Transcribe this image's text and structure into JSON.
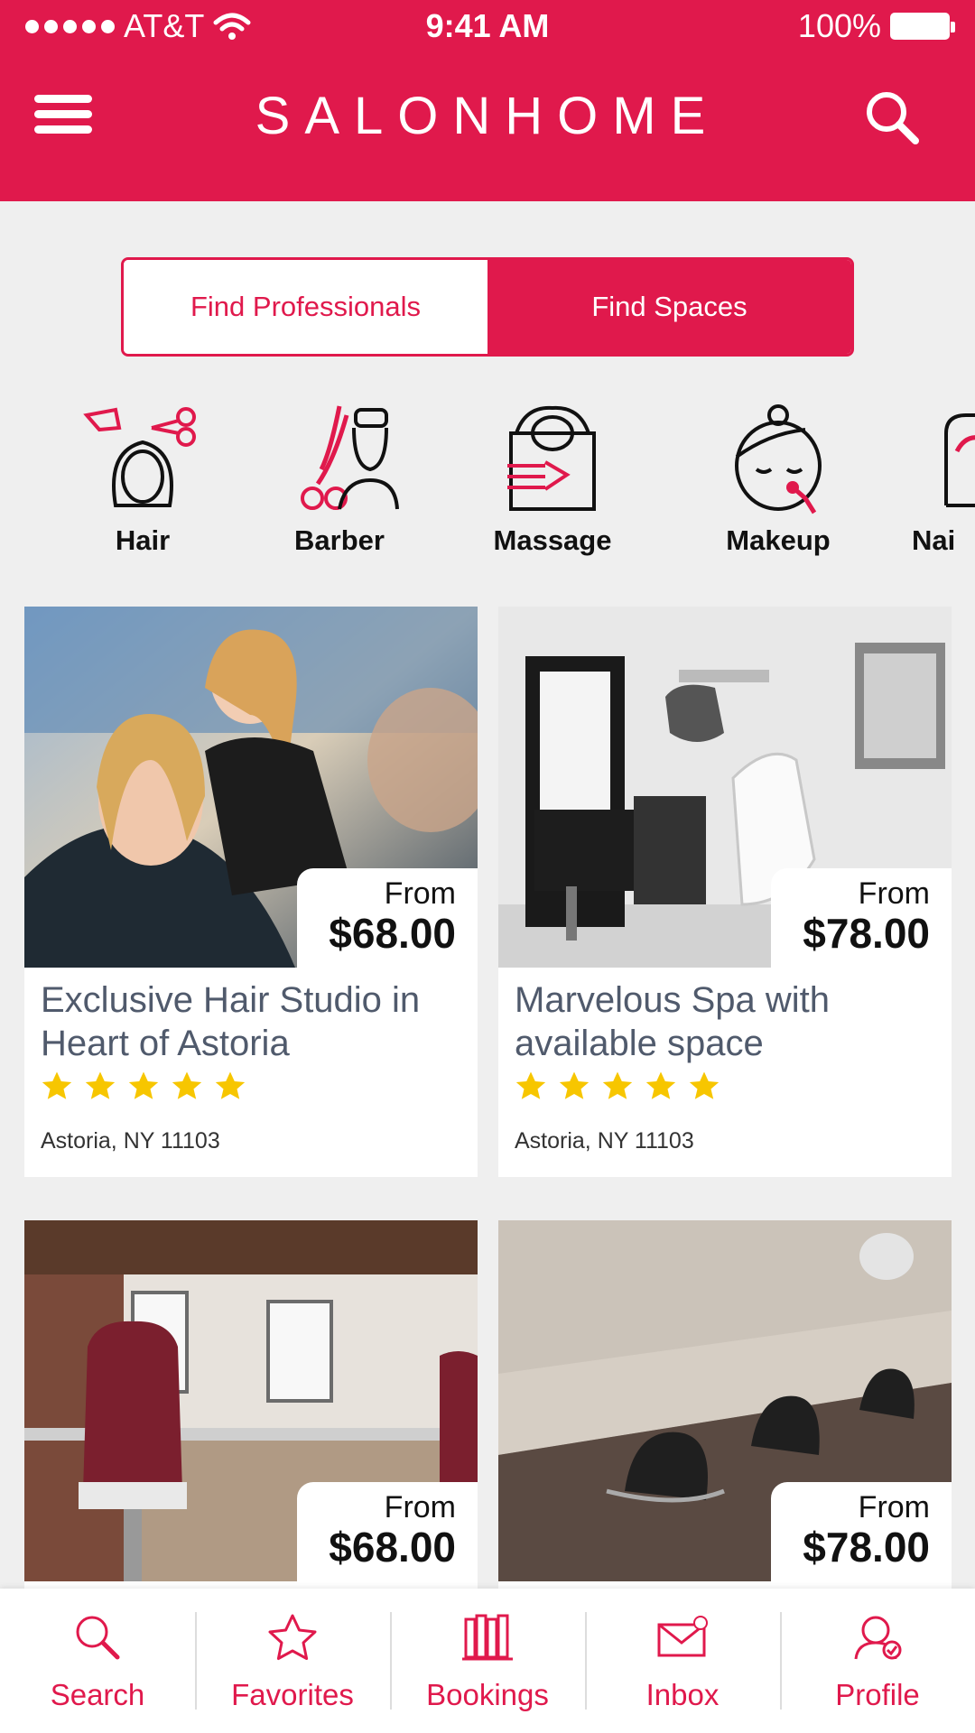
{
  "status": {
    "carrier": "AT&T",
    "time": "9:41 AM",
    "battery": "100%"
  },
  "header": {
    "logo": "SALONHOME"
  },
  "segment": {
    "left": "Find Professionals",
    "right": "Find Spaces",
    "active": "Find Spaces"
  },
  "categories": [
    {
      "label": "Hair",
      "icon": "hair-icon"
    },
    {
      "label": "Barber",
      "icon": "barber-icon"
    },
    {
      "label": "Massage",
      "icon": "massage-icon"
    },
    {
      "label": "Makeup",
      "icon": "makeup-icon"
    },
    {
      "label": "Nai",
      "icon": "nails-icon"
    }
  ],
  "listings": [
    {
      "from": "From",
      "price": "$68.00",
      "title": "Exclusive Hair Studio in Heart of Astoria",
      "rating": 5,
      "address": "Astoria, NY 11103"
    },
    {
      "from": "From",
      "price": "$78.00",
      "title": "Marvelous Spa with available space",
      "rating": 5,
      "address": "Astoria, NY 11103"
    },
    {
      "from": "From",
      "price": "$68.00"
    },
    {
      "from": "From",
      "price": "$78.00"
    }
  ],
  "tabs": [
    {
      "label": "Search",
      "icon": "search-icon"
    },
    {
      "label": "Favorites",
      "icon": "star-icon"
    },
    {
      "label": "Bookings",
      "icon": "books-icon"
    },
    {
      "label": "Inbox",
      "icon": "envelope-icon"
    },
    {
      "label": "Profile",
      "icon": "user-check-icon"
    }
  ],
  "colors": {
    "accent": "#e0194c",
    "star": "#f7c600",
    "title": "#505a6c"
  }
}
